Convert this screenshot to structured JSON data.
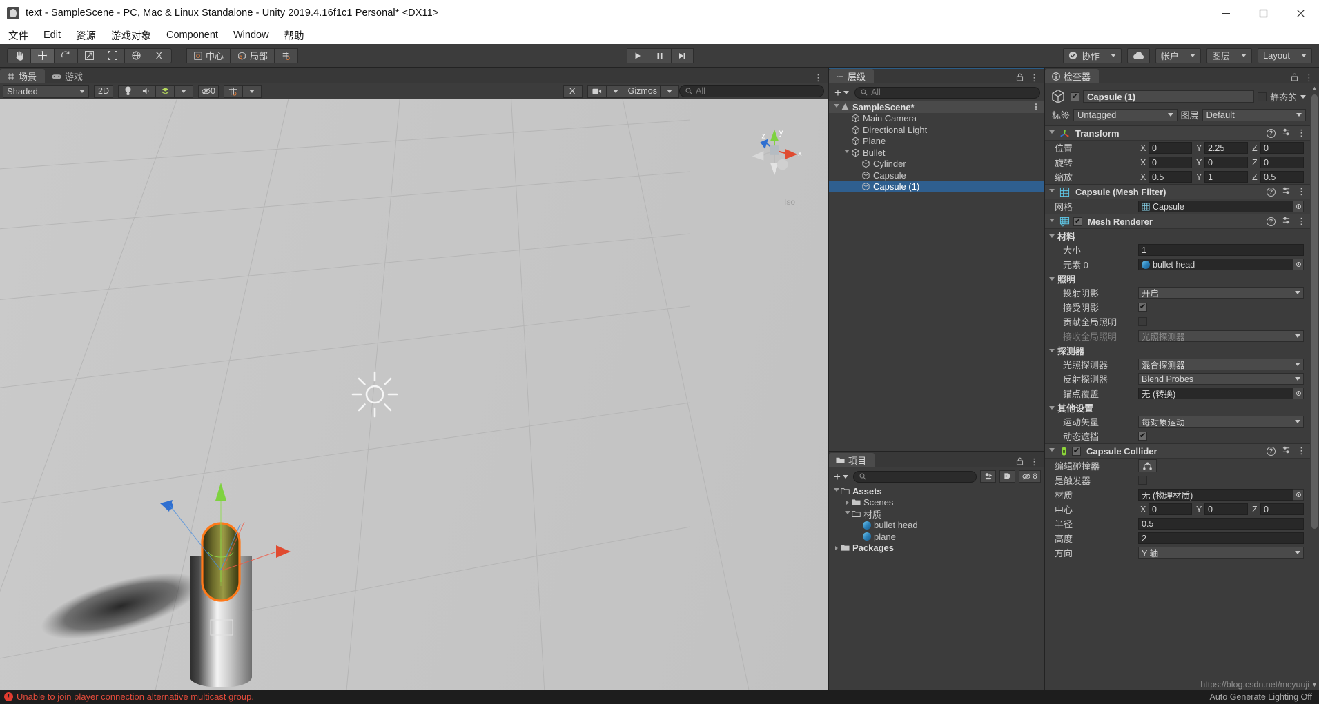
{
  "window": {
    "title": "text - SampleScene - PC, Mac & Linux Standalone - Unity 2019.4.16f1c1 Personal* <DX11>",
    "minimize_label": "─",
    "maximize_label": "☐",
    "close_label": "✕"
  },
  "menu": {
    "items": [
      "文件",
      "Edit",
      "资源",
      "游戏对象",
      "Component",
      "Window",
      "帮助"
    ]
  },
  "toolbar": {
    "transform_tools": [
      {
        "name": "hand-tool",
        "selected": false
      },
      {
        "name": "move-tool",
        "selected": true
      },
      {
        "name": "rotate-tool",
        "selected": false
      },
      {
        "name": "scale-tool",
        "selected": false
      },
      {
        "name": "rect-tool",
        "selected": false
      },
      {
        "name": "transform-tool",
        "selected": false
      },
      {
        "name": "custom-tool",
        "selected": false
      }
    ],
    "pivot_mode": "中心",
    "pivot_rotation": "局部",
    "snap_label": "",
    "play": "▶",
    "pause": "‖",
    "step": "▶|",
    "collab": "协作",
    "cloud_icon": "cloud-icon",
    "account": "帐户",
    "layers": "图层",
    "layout": "Layout"
  },
  "scene": {
    "tabs": [
      {
        "label": "场景",
        "icon": "scene-icon",
        "active": true
      },
      {
        "label": "游戏",
        "icon": "game-icon",
        "active": false
      }
    ],
    "draw_mode": "Shaded",
    "two_d": "2D",
    "light_icon": "light-icon",
    "audio_icon": "audio-icon",
    "fx_icon": "effects-icon",
    "hidden_count": "0",
    "grid_icon": "grid-icon",
    "tools_icon": "tools-icon",
    "camera_icon": "camera-icon",
    "gizmos": "Gizmos",
    "search_placeholder": "All",
    "axis_labels": {
      "x": "x",
      "y": "y",
      "z": "z"
    },
    "view_mode_label": "Iso"
  },
  "hierarchy": {
    "tab_label": "层级",
    "create_label": "+",
    "search_placeholder": "All",
    "items": [
      {
        "label": "SampleScene*",
        "depth": 0,
        "expanded": true,
        "kind": "scene",
        "selected": false
      },
      {
        "label": "Main Camera",
        "depth": 1,
        "expanded": null,
        "kind": "object",
        "selected": false
      },
      {
        "label": "Directional Light",
        "depth": 1,
        "expanded": null,
        "kind": "object",
        "selected": false
      },
      {
        "label": "Plane",
        "depth": 1,
        "expanded": null,
        "kind": "object",
        "selected": false
      },
      {
        "label": "Bullet",
        "depth": 1,
        "expanded": true,
        "kind": "object",
        "selected": false
      },
      {
        "label": "Cylinder",
        "depth": 2,
        "expanded": null,
        "kind": "object",
        "selected": false
      },
      {
        "label": "Capsule",
        "depth": 2,
        "expanded": null,
        "kind": "object",
        "selected": false
      },
      {
        "label": "Capsule (1)",
        "depth": 2,
        "expanded": null,
        "kind": "object",
        "selected": true
      }
    ]
  },
  "project": {
    "tab_label": "项目",
    "create_label": "+",
    "search_placeholder": "",
    "favorites_icon": "favorites-icon",
    "label_icon": "label-icon",
    "visibility_count": "8",
    "items": [
      {
        "label": "Assets",
        "depth": 0,
        "expanded": true,
        "kind": "folder-open",
        "bold": true
      },
      {
        "label": "Scenes",
        "depth": 1,
        "expanded": false,
        "kind": "folder",
        "bold": false
      },
      {
        "label": "材质",
        "depth": 1,
        "expanded": true,
        "kind": "folder-open",
        "bold": false
      },
      {
        "label": "bullet head",
        "depth": 2,
        "expanded": null,
        "kind": "material",
        "bold": false
      },
      {
        "label": "plane",
        "depth": 2,
        "expanded": null,
        "kind": "material",
        "bold": false
      },
      {
        "label": "Packages",
        "depth": 0,
        "expanded": false,
        "kind": "folder",
        "bold": true
      }
    ]
  },
  "inspector": {
    "tab_label": "检查器",
    "object_name": "Capsule (1)",
    "object_enabled": true,
    "static_label": "静态的",
    "static_checked": false,
    "tag_label": "标签",
    "tag_value": "Untagged",
    "layer_label": "图层",
    "layer_value": "Default",
    "components": [
      {
        "name": "transform",
        "title": "Transform",
        "icon": "transform-icon",
        "has_toggle": false,
        "rows": [
          {
            "type": "vec3",
            "label": "位置",
            "x": "0",
            "y": "2.25",
            "z": "0"
          },
          {
            "type": "vec3",
            "label": "旋转",
            "x": "0",
            "y": "0",
            "z": "0"
          },
          {
            "type": "vec3",
            "label": "缩放",
            "x": "0.5",
            "y": "1",
            "z": "0.5"
          }
        ]
      },
      {
        "name": "mesh-filter",
        "title": "Capsule (Mesh Filter)",
        "icon": "mesh-filter-icon",
        "has_toggle": false,
        "rows": [
          {
            "type": "object",
            "label": "网格",
            "value": "Capsule",
            "icon": "mesh-icon"
          }
        ]
      },
      {
        "name": "mesh-renderer",
        "title": "Mesh Renderer",
        "icon": "mesh-renderer-icon",
        "has_toggle": true,
        "toggle_checked": true,
        "rows": [
          {
            "type": "fold",
            "label": "材料",
            "indent": 0
          },
          {
            "type": "text",
            "label": "大小",
            "value": "1",
            "indent": 1
          },
          {
            "type": "object",
            "label": "元素 0",
            "value": "bullet head",
            "icon": "material-icon",
            "indent": 1
          },
          {
            "type": "fold",
            "label": "照明",
            "indent": 0
          },
          {
            "type": "dropdown",
            "label": "投射阴影",
            "value": "开启",
            "indent": 1
          },
          {
            "type": "checkbox",
            "label": "接受阴影",
            "checked": true,
            "indent": 1
          },
          {
            "type": "checkbox",
            "label": "贡献全局照明",
            "checked": false,
            "indent": 1
          },
          {
            "type": "dropdown",
            "label": "接收全局照明",
            "value": "光照探测器",
            "indent": 1,
            "disabled": true
          },
          {
            "type": "fold",
            "label": "探测器",
            "indent": 0
          },
          {
            "type": "dropdown",
            "label": "光照探测器",
            "value": "混合探测器",
            "indent": 1
          },
          {
            "type": "dropdown",
            "label": "反射探测器",
            "value": "Blend Probes",
            "indent": 1
          },
          {
            "type": "object",
            "label": "锚点覆盖",
            "value": "无 (转换)",
            "icon": "",
            "indent": 1
          },
          {
            "type": "fold",
            "label": "其他设置",
            "indent": 0
          },
          {
            "type": "dropdown",
            "label": "运动矢量",
            "value": "每对象运动",
            "indent": 1
          },
          {
            "type": "checkbox",
            "label": "动态遮挡",
            "checked": true,
            "indent": 1
          }
        ]
      },
      {
        "name": "capsule-collider",
        "title": "Capsule Collider",
        "icon": "collider-icon",
        "has_toggle": true,
        "toggle_checked": true,
        "rows": [
          {
            "type": "editbtn",
            "label": "编辑碰撞器",
            "indent": 0
          },
          {
            "type": "checkbox",
            "label": "是触发器",
            "checked": false,
            "indent": 0
          },
          {
            "type": "object",
            "label": "材质",
            "value": "无 (物理材质)",
            "icon": "",
            "indent": 0
          },
          {
            "type": "vec3",
            "label": "中心",
            "x": "0",
            "y": "0",
            "z": "0"
          },
          {
            "type": "text",
            "label": "半径",
            "value": "0.5",
            "indent": 0
          },
          {
            "type": "text",
            "label": "高度",
            "value": "2",
            "indent": 0
          },
          {
            "type": "dropdown",
            "label": "方向",
            "value": "Y 轴",
            "indent": 0
          }
        ]
      }
    ]
  },
  "status": {
    "error_text": "Unable to join player connection alternative multicast group.",
    "error_icon": "error-icon",
    "lighting_text": "Auto Generate Lighting Off",
    "watermark": "https://blog.csdn.net/mcyuuji"
  }
}
